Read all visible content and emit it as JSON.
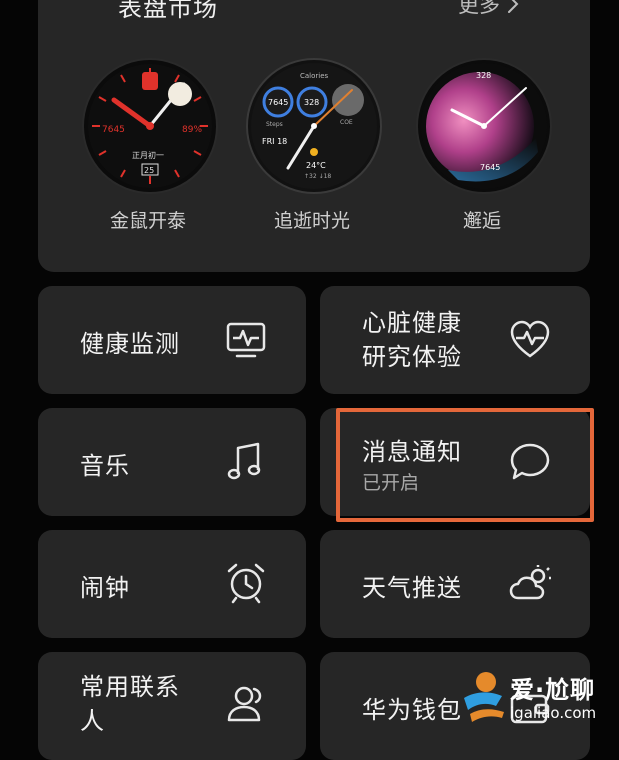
{
  "market": {
    "title": "表盘市场",
    "more_label": "更多",
    "faces": [
      {
        "label": "金鼠开泰",
        "dial_text_left": "7645",
        "dial_text_right": "89%",
        "dial_date_line": "正月初一",
        "dial_date_num": "25"
      },
      {
        "label": "追逝时光",
        "dial_top": "Calories",
        "ring1": "7645",
        "ring2": "328",
        "ring3": "COE",
        "steps_label": "Steps",
        "date": "FRI 18",
        "temp": "24°C",
        "temp_range": "↑32  ↓18"
      },
      {
        "label": "邂逅",
        "dial_top": "328",
        "dial_bottom": "7645"
      }
    ]
  },
  "tiles": {
    "health": {
      "label": "健康监测",
      "icon": "heart-monitor-icon"
    },
    "heart_study": {
      "label_line1": "心脏健康",
      "label_line2": "研究体验",
      "icon": "heart-pulse-icon"
    },
    "music": {
      "label": "音乐",
      "icon": "music-note-icon"
    },
    "notification": {
      "label": "消息通知",
      "status": "已开启",
      "icon": "message-bubble-icon"
    },
    "alarm": {
      "label": "闹钟",
      "icon": "alarm-clock-icon"
    },
    "weather": {
      "label": "天气推送",
      "icon": "weather-cloud-sun-icon"
    },
    "contacts": {
      "label_line1": "常用联系",
      "label_line2": "人",
      "icon": "contacts-person-icon"
    },
    "wallet": {
      "label": "华为钱包",
      "icon": "wallet-icon"
    }
  },
  "colors": {
    "card": "#262626",
    "highlight": "#e4673a",
    "face1_accent": "#e0322b",
    "face3_gradient": "#d05fa0"
  },
  "watermark": {
    "line1": "爱·尬聊",
    "line2": "igaliao.com"
  }
}
